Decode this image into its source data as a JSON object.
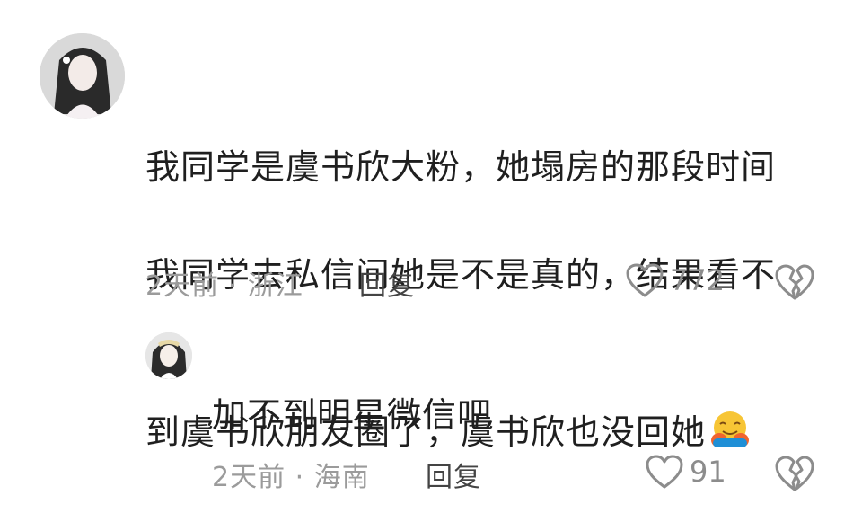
{
  "comments": [
    {
      "text_lines": [
        "我同学是虞书欣大粉，她塌房的那段时间",
        "我同学去私信问她是不是真的，结果看不",
        "到虞书欣朋友圈了，虞书欣也没回她"
      ],
      "emoji": "hugging-face-icon",
      "time": "2天前",
      "location": "浙江",
      "reply_label": "回复",
      "like_count": "772"
    },
    {
      "text": "加不到明星微信吧",
      "time": "2天前",
      "location": "海南",
      "reply_label": "回复",
      "like_count": "91"
    }
  ],
  "colors": {
    "text": "#1f1f1f",
    "meta": "#9b9b9b",
    "reply": "#444444"
  }
}
